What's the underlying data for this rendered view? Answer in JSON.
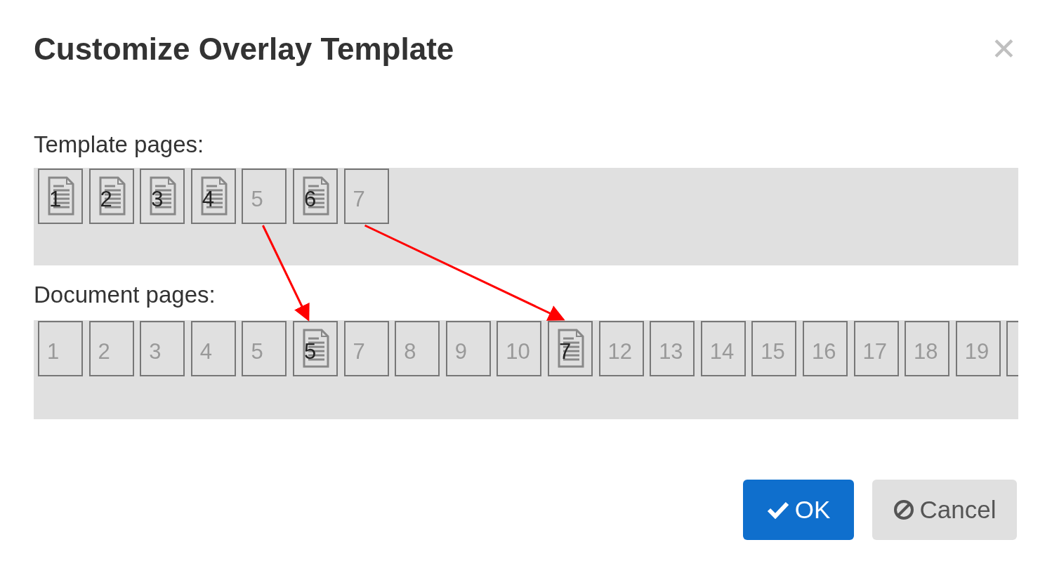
{
  "dialog": {
    "title": "Customize Overlay Template",
    "close": "✕"
  },
  "template_pages": {
    "label": "Template pages:",
    "pages": [
      {
        "label": "1",
        "kind": "filled"
      },
      {
        "label": "2",
        "kind": "filled"
      },
      {
        "label": "3",
        "kind": "filled"
      },
      {
        "label": "4",
        "kind": "filled"
      },
      {
        "label": "5",
        "kind": "empty"
      },
      {
        "label": "6",
        "kind": "filled"
      },
      {
        "label": "7",
        "kind": "empty"
      }
    ]
  },
  "document_pages": {
    "label": "Document pages:",
    "pages": [
      {
        "label": "1",
        "kind": "empty"
      },
      {
        "label": "2",
        "kind": "empty"
      },
      {
        "label": "3",
        "kind": "empty"
      },
      {
        "label": "4",
        "kind": "empty"
      },
      {
        "label": "5",
        "kind": "empty"
      },
      {
        "label": "5",
        "kind": "mapped"
      },
      {
        "label": "7",
        "kind": "empty"
      },
      {
        "label": "8",
        "kind": "empty"
      },
      {
        "label": "9",
        "kind": "empty"
      },
      {
        "label": "10",
        "kind": "empty"
      },
      {
        "label": "7",
        "kind": "mapped"
      },
      {
        "label": "12",
        "kind": "empty"
      },
      {
        "label": "13",
        "kind": "empty"
      },
      {
        "label": "14",
        "kind": "empty"
      },
      {
        "label": "15",
        "kind": "empty"
      },
      {
        "label": "16",
        "kind": "empty"
      },
      {
        "label": "17",
        "kind": "empty"
      },
      {
        "label": "18",
        "kind": "empty"
      },
      {
        "label": "19",
        "kind": "empty"
      },
      {
        "kind": "cut"
      }
    ]
  },
  "buttons": [
    {
      "label": "OK",
      "kind": "primary"
    },
    {
      "label": "Cancel",
      "kind": "secondary"
    }
  ]
}
